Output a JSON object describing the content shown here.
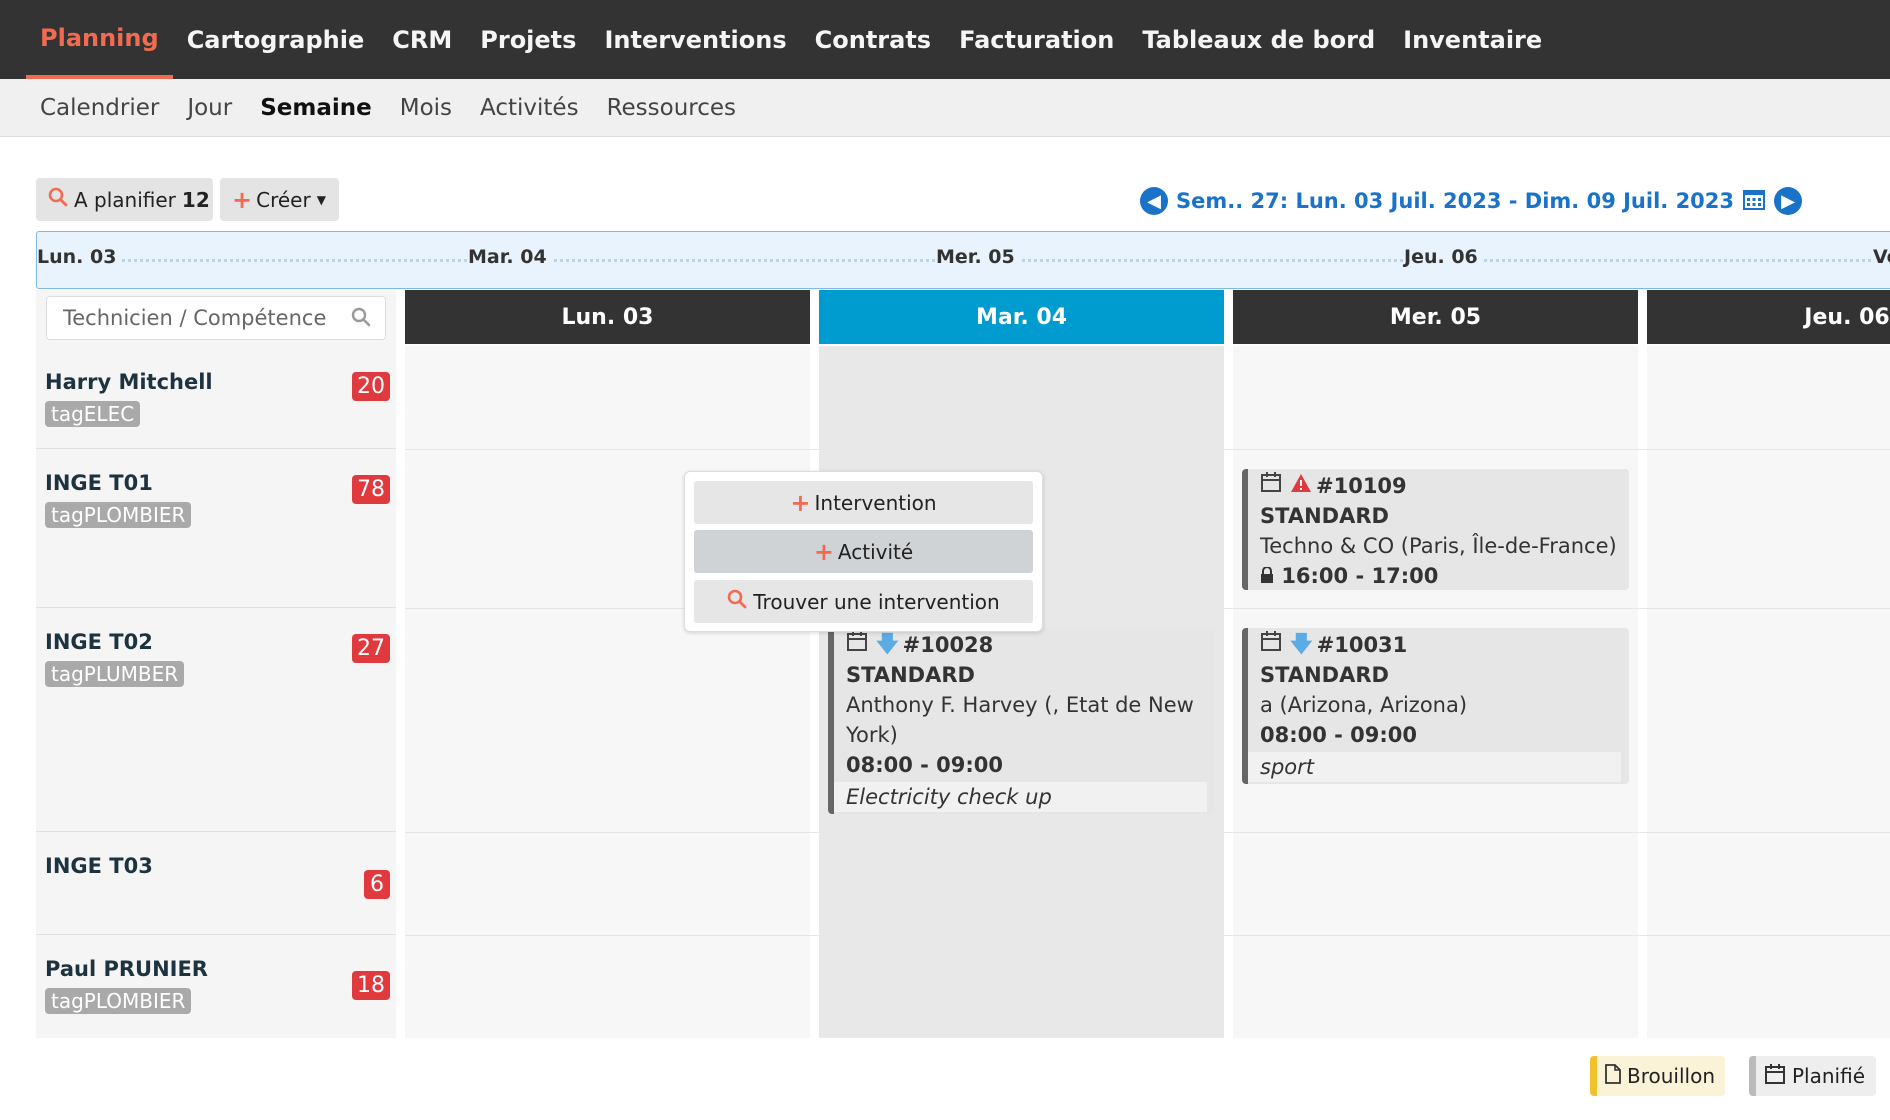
{
  "topnav": [
    "Planning",
    "Cartographie",
    "CRM",
    "Projets",
    "Interventions",
    "Contrats",
    "Facturation",
    "Tableaux de bord",
    "Inventaire"
  ],
  "subnav": [
    "Calendrier",
    "Jour",
    "Semaine",
    "Mois",
    "Activités",
    "Ressources"
  ],
  "toolbar": {
    "a_planifier_label": "A planifier",
    "a_planifier_count": "12",
    "creer_label": "Créer",
    "week_range": "Sem.. 27: Lun. 03 Juil. 2023 - Dim. 09 Juil. 2023"
  },
  "timeline": [
    "Lun. 03",
    "Mar. 04",
    "Mer. 05",
    "Jeu. 06",
    "Ve"
  ],
  "search": {
    "placeholder": "Technicien / Compétence"
  },
  "days": [
    "Lun. 03",
    "Mar. 04",
    "Mer. 05",
    "Jeu. 06"
  ],
  "technicians": [
    {
      "name": "Harry Mitchell",
      "tag": "tagELEC",
      "count": "20"
    },
    {
      "name": "INGE T01",
      "tag": "tagPLOMBIER",
      "count": "78"
    },
    {
      "name": "INGE T02",
      "tag": "tagPLUMBER",
      "count": "27"
    },
    {
      "name": "INGE T03",
      "tag": "",
      "count": "6"
    },
    {
      "name": "Paul PRUNIER",
      "tag": "tagPLOMBIER",
      "count": "18"
    }
  ],
  "popup": {
    "intervention": "Intervention",
    "activite": "Activité",
    "trouver": "Trouver une intervention"
  },
  "cards": {
    "c10109": {
      "id": "#10109",
      "type": "STANDARD",
      "client": "Techno & CO (Paris, Île-de-France)",
      "time": "16:00 - 17:00"
    },
    "c10028": {
      "id": "#10028",
      "type": "STANDARD",
      "client_l1": "Anthony F. Harvey (, Etat de New",
      "client_l2": "York)",
      "time": "08:00 - 09:00",
      "note": "Electricity check up"
    },
    "c10031": {
      "id": "#10031",
      "type": "STANDARD",
      "client": "a (Arizona, Arizona)",
      "time": "08:00 - 09:00",
      "note": "sport"
    }
  },
  "legend": {
    "brouillon": "Brouillon",
    "planifie": "Planifié"
  },
  "colors": {
    "accent": "#f26a50",
    "today": "#009ccf",
    "link": "#1a73c8",
    "badge": "#e0393e",
    "draft": "#f2c12e"
  }
}
